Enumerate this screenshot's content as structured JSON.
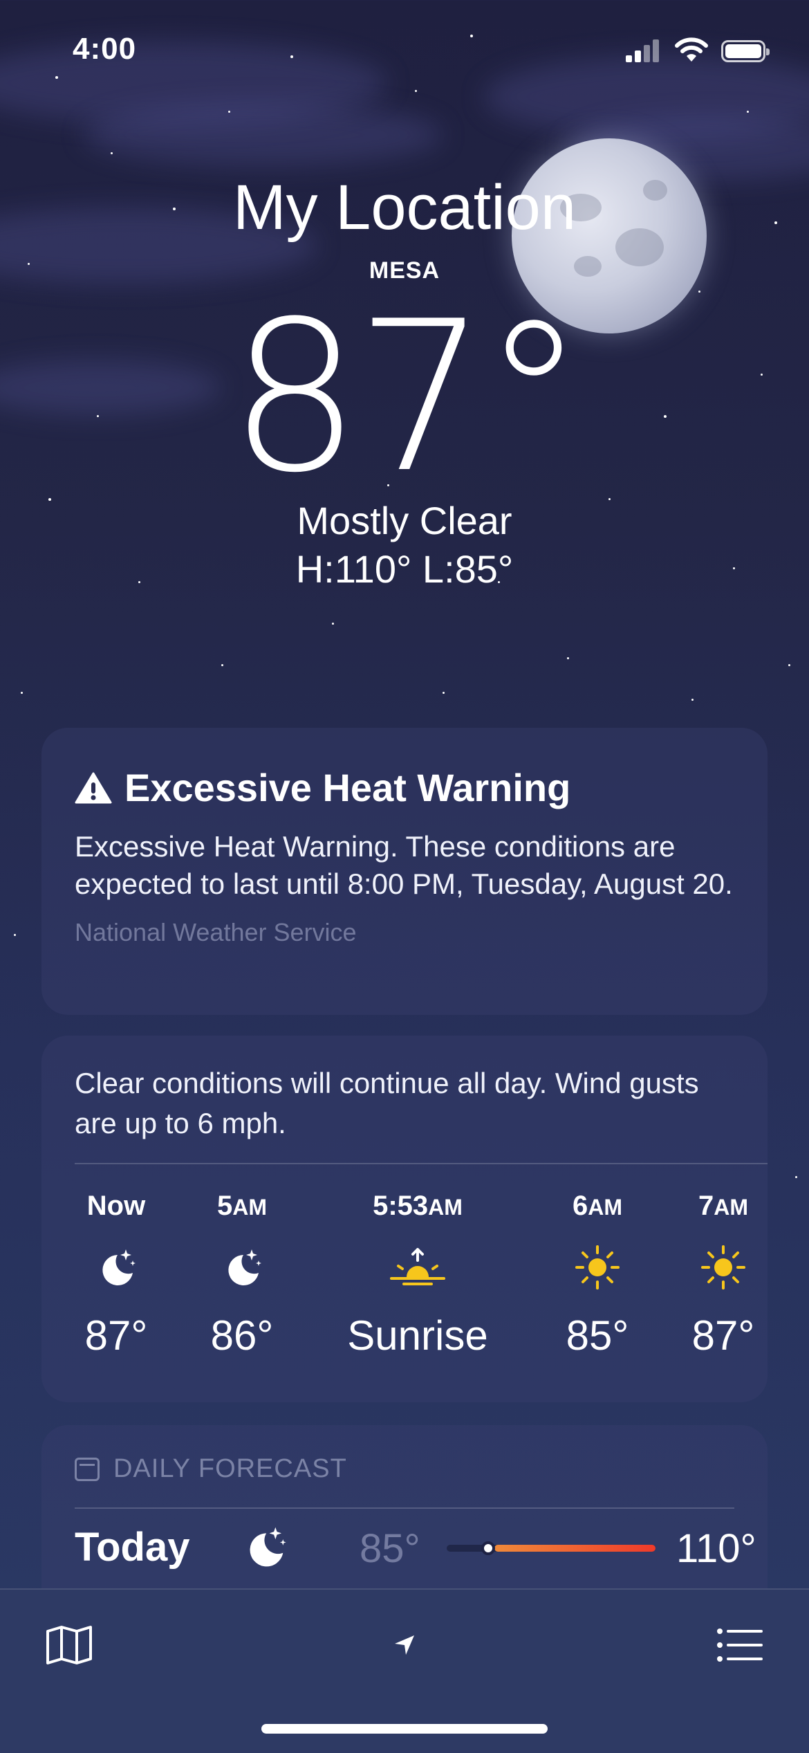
{
  "status_bar": {
    "time": "4:00"
  },
  "header": {
    "title": "My Location",
    "city": "MESA",
    "temperature": "87°",
    "condition": "Mostly Clear",
    "high_low": "H:110°  L:85°"
  },
  "alert": {
    "title": "Excessive Heat Warning",
    "body": "Excessive Heat Warning. These conditions are expected to last until 8:00 PM, Tuesday, August 20.",
    "source": "National Weather Service"
  },
  "hourly": {
    "summary": "Clear conditions will continue all day. Wind gusts are up to 6 mph.",
    "items": [
      {
        "label": "Now",
        "suffix": "",
        "icon": "moon-stars-icon",
        "value": "87°"
      },
      {
        "label": "5",
        "suffix": "AM",
        "icon": "moon-stars-icon",
        "value": "86°"
      },
      {
        "label": "5:53",
        "suffix": "AM",
        "icon": "sunrise-icon",
        "value": "Sunrise"
      },
      {
        "label": "6",
        "suffix": "AM",
        "icon": "sun-icon",
        "value": "85°"
      },
      {
        "label": "7",
        "suffix": "AM",
        "icon": "sun-icon",
        "value": "87°"
      }
    ]
  },
  "daily": {
    "heading": "DAILY FORECAST",
    "days": [
      {
        "name": "Today",
        "icon": "moon-stars-icon",
        "low": "85°",
        "high": "110°",
        "range_start": 0.23,
        "range_end": 1.0,
        "current": 0.2
      }
    ]
  },
  "colors": {
    "sun": "#f7c61c",
    "range_start": "#f08a3a",
    "range_end": "#ef3a2a",
    "background_top": "#1f2040",
    "background_bottom": "#2b3a66"
  },
  "toolbar": {
    "left_icon": "map-icon",
    "center_icon": "location-arrow-icon",
    "right_icon": "list-icon"
  }
}
